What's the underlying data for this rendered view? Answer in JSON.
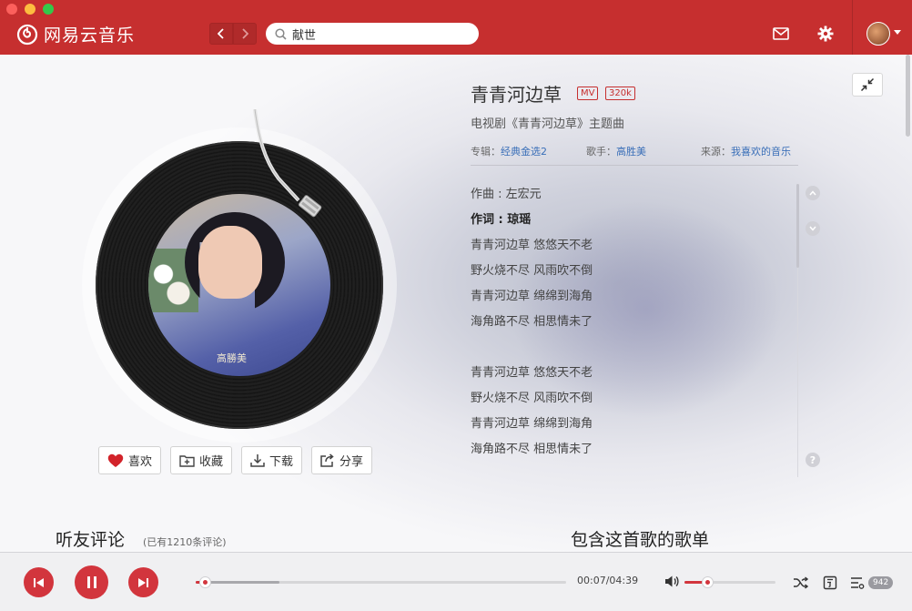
{
  "app": {
    "name": "网易云音乐"
  },
  "search": {
    "query": "献世"
  },
  "song": {
    "title": "青青河边草",
    "tags": [
      "MV",
      "320k"
    ],
    "subtitle": "电视剧《青青河边草》主题曲",
    "album_label": "专辑：",
    "album": "经典金选2",
    "artist_label": "歌手：",
    "artist": "高胜美",
    "source_label": "来源：",
    "source": "我喜欢的音乐",
    "cover_text": "高勝美"
  },
  "actions": [
    {
      "label": "喜欢",
      "icon": "heart-icon"
    },
    {
      "label": "收藏",
      "icon": "add-folder-icon"
    },
    {
      "label": "下载",
      "icon": "download-icon"
    },
    {
      "label": "分享",
      "icon": "share-icon"
    }
  ],
  "lyrics": [
    "作曲 : 左宏元",
    "作词 : 琼瑶",
    "青青河边草 悠悠天不老",
    "野火烧不尽 风雨吹不倒",
    "青青河边草 绵绵到海角",
    "海角路不尽 相思情未了",
    "",
    "青青河边草 悠悠天不老",
    "野火烧不尽 风雨吹不倒",
    "青青河边草 绵绵到海角",
    "海角路不尽 相思情未了"
  ],
  "active_lyric_index": 1,
  "comments": {
    "title": "听友评论",
    "count": "(已有1210条评论)"
  },
  "playlists": {
    "title": "包含这首歌的歌单"
  },
  "player": {
    "elapsed": "00:07",
    "duration": "04:39",
    "time_display": "00:07/04:39",
    "progress_fraction": 0.025,
    "buffered_fraction": 0.225,
    "volume_fraction": 0.25,
    "queue_count": "942"
  },
  "colors": {
    "accent": "#c62f2f",
    "link": "#3a6fb8"
  }
}
